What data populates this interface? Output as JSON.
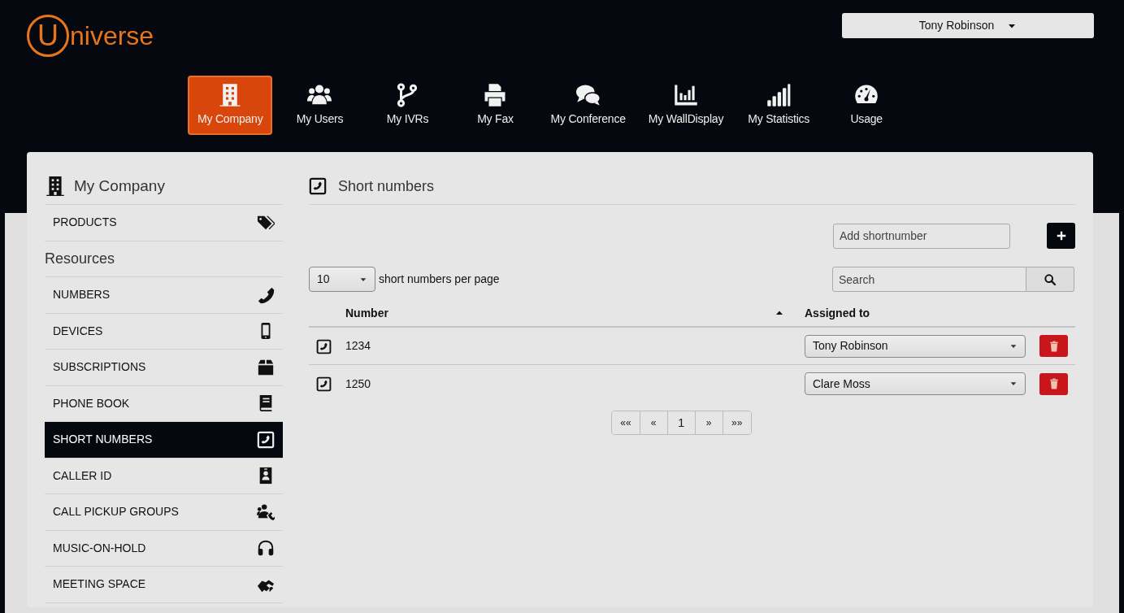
{
  "header": {
    "logo": {
      "mark": "U",
      "text": "niverse"
    },
    "user_menu": {
      "label": "Tony Robinson"
    }
  },
  "nav": [
    {
      "label": "My Company",
      "selected": true
    },
    {
      "label": "My Users",
      "selected": false
    },
    {
      "label": "My IVRs",
      "selected": false
    },
    {
      "label": "My Fax",
      "selected": false
    },
    {
      "label": "My Conference",
      "selected": false
    },
    {
      "label": "My WallDisplay",
      "selected": false
    },
    {
      "label": "My Statistics",
      "selected": false
    },
    {
      "label": "Usage",
      "selected": false
    }
  ],
  "sidebar": {
    "title": "My Company",
    "items": [
      {
        "kind": "item",
        "label": "PRODUCTS",
        "selected": false
      },
      {
        "kind": "heading",
        "label": "Resources"
      },
      {
        "kind": "item",
        "label": "NUMBERS",
        "selected": false
      },
      {
        "kind": "item",
        "label": "DEVICES",
        "selected": false
      },
      {
        "kind": "item",
        "label": "SUBSCRIPTIONS",
        "selected": false
      },
      {
        "kind": "item",
        "label": "PHONE BOOK",
        "selected": false
      },
      {
        "kind": "item",
        "label": "SHORT NUMBERS",
        "selected": true
      },
      {
        "kind": "item",
        "label": "CALLER ID",
        "selected": false
      },
      {
        "kind": "item",
        "label": "CALL PICKUP GROUPS",
        "selected": false
      },
      {
        "kind": "item",
        "label": "MUSIC-ON-HOLD",
        "selected": false
      },
      {
        "kind": "item",
        "label": "MEETING SPACE",
        "selected": false
      }
    ]
  },
  "main": {
    "title": "Short numbers",
    "add_field": {
      "placeholder": "Add shortnumber"
    },
    "page_size": {
      "value": "10",
      "suffix": "short numbers per page"
    },
    "search": {
      "placeholder": "Search"
    },
    "table": {
      "columns": [
        {
          "label": "Number",
          "sorted": true
        },
        {
          "label": "Assigned to",
          "sorted": false
        }
      ],
      "rows": [
        {
          "number": "1234",
          "assigned": "Tony Robinson"
        },
        {
          "number": "1250",
          "assigned": "Clare Moss"
        }
      ]
    },
    "pagination": [
      "««",
      "«",
      "1",
      "»",
      "»»"
    ]
  }
}
